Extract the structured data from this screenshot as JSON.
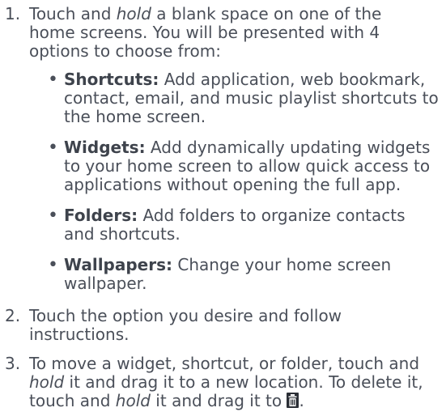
{
  "steps": [
    {
      "number": "1.",
      "lines": [
        [
          "Touch and ",
          {
            "em": "hold"
          },
          " a blank space on one of the"
        ],
        [
          "home screens. You will be presented with 4"
        ],
        [
          "options to choose from:"
        ]
      ]
    },
    {
      "number": "2.",
      "lines": [
        [
          "Touch the option you desire and follow"
        ],
        [
          "instructions."
        ]
      ]
    },
    {
      "number": "3.",
      "lines": [
        [
          "To move a widget, shortcut, or folder, touch and"
        ],
        [
          {
            "em": "hold"
          },
          " it and drag it to a new location. To delete it,"
        ],
        [
          "touch and ",
          {
            "em": "hold"
          },
          " it and drag it to ",
          {
            "icon": "trash-icon"
          },
          "."
        ]
      ]
    }
  ],
  "bullets": [
    {
      "term": "Shortcuts:",
      "lines": [
        " Add application, web bookmark,",
        "contact, email, and music playlist shortcuts to",
        "the home screen."
      ]
    },
    {
      "term": "Widgets:",
      "lines": [
        " Add dynamically updating widgets",
        "to your home screen to allow quick access to",
        "applications without opening the full app."
      ]
    },
    {
      "term": "Folders:",
      "lines": [
        " Add folders to organize contacts",
        "and shortcuts."
      ]
    },
    {
      "term": "Wallpapers:",
      "lines": [
        " Change your home screen",
        "wallpaper."
      ]
    }
  ],
  "bullet_glyph": "•",
  "icons": {
    "trash": "trash-icon"
  }
}
